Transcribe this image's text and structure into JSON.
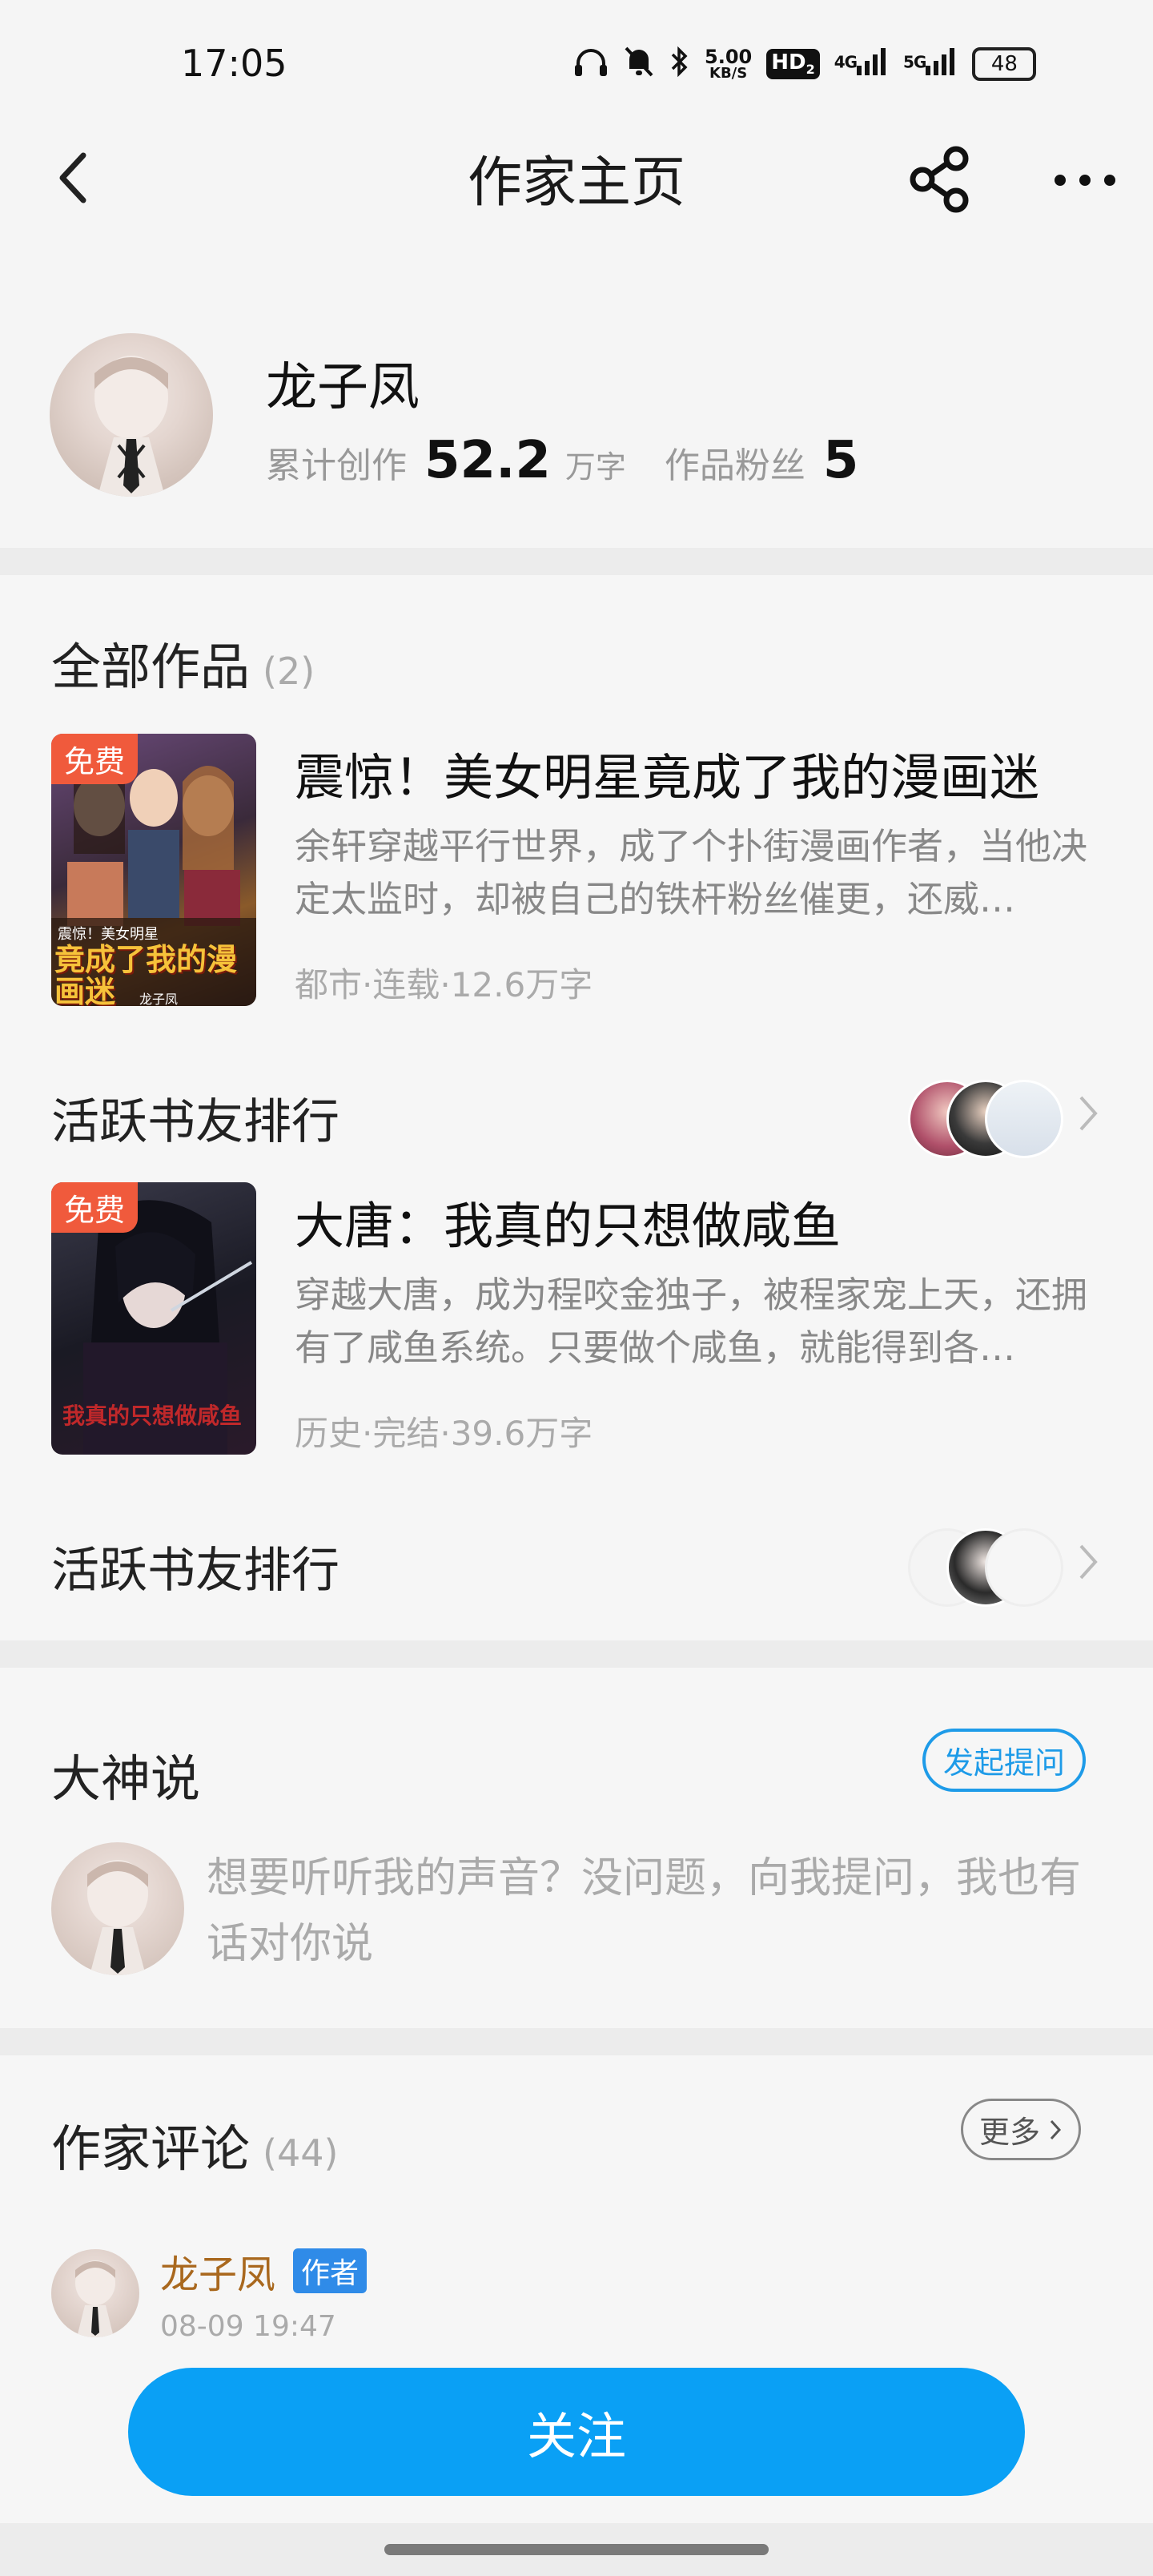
{
  "status_bar": {
    "time": "17:05",
    "net_speed_value": "5.00",
    "net_speed_unit": "KB/S",
    "hd": "HD",
    "hd_sub": "2",
    "sig1": "4G",
    "sig2": "5G",
    "battery": "48"
  },
  "nav": {
    "title": "作家主页"
  },
  "author": {
    "name": "龙子凤",
    "total_label": "累计创作",
    "total_value": "52.2",
    "total_unit": "万字",
    "fans_label": "作品粉丝",
    "fans_value": "5"
  },
  "works": {
    "title": "全部作品",
    "count": "(2)",
    "books": [
      {
        "badge": "免费",
        "title": "震惊！美女明星竟成了我的漫画迷",
        "desc": "余轩穿越平行世界，成了个扑街漫画作者，当他决定太监时，却被自己的铁杆粉丝催更，还威…",
        "meta": "都市·连载·12.6万字",
        "cover_title": "竟成了我的漫画迷",
        "cover_small": "震惊！美女明星",
        "cover_author": "龙子凤",
        "rank_label": "活跃书友排行"
      },
      {
        "badge": "免费",
        "title": "大唐：我真的只想做咸鱼",
        "desc": "穿越大唐，成为程咬金独子，被程家宠上天，还拥有了咸鱼系统。只要做个咸鱼，就能得到各…",
        "meta": "历史·完结·39.6万字",
        "cover_title": "我真的只想做咸鱼",
        "rank_label": "活跃书友排行"
      }
    ]
  },
  "dashen": {
    "title": "大神说",
    "ask_button": "发起提问",
    "prompt": "想要听听我的声音？没问题，向我提问，我也有话对你说"
  },
  "comments": {
    "title": "作家评论",
    "count": "(44)",
    "more": "更多",
    "items": [
      {
        "name": "龙子凤",
        "tag": "作者",
        "time": "08-09 19:47"
      }
    ]
  },
  "follow_button": "关注",
  "colors": {
    "accent_blue": "#0aa0f5",
    "free_badge": "#f05a3c",
    "author_name_brown": "#a9681e"
  }
}
